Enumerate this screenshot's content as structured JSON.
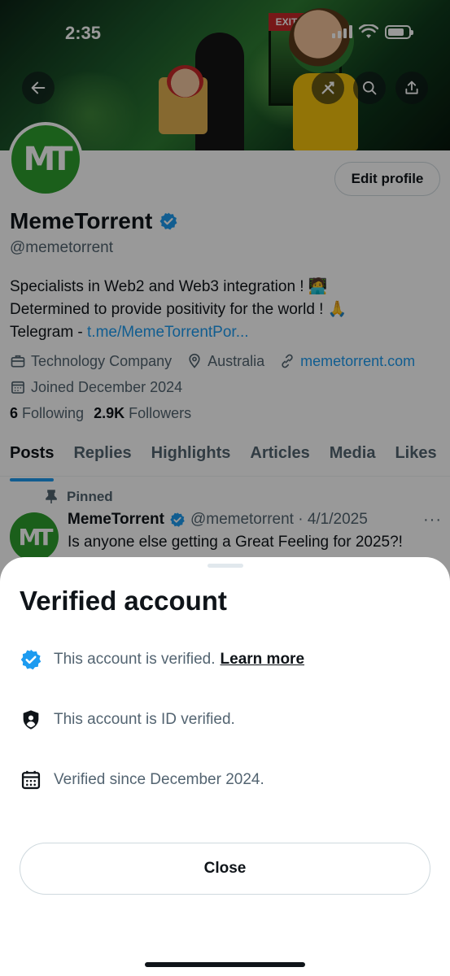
{
  "status_bar": {
    "time": "2:35"
  },
  "profile": {
    "display_name": "MemeTorrent",
    "handle": "@memetorrent",
    "edit_button": "Edit profile",
    "bio_line1": "Specialists in Web2 and Web3 integration ! 🧑‍💻",
    "bio_line2": "Determined to provide positivity for the world ! 🙏",
    "bio_line3_prefix": "Telegram - ",
    "bio_line3_link": "t.me/MemeTorrentPor...",
    "category": "Technology Company",
    "location": "Australia",
    "website": "memetorrent.com",
    "joined": "Joined December 2024",
    "following_count": "6",
    "following_label": "Following",
    "followers_count": "2.9K",
    "followers_label": "Followers",
    "banner_sign": "EXIT",
    "avatar_text": "MT"
  },
  "tabs": [
    "Posts",
    "Replies",
    "Highlights",
    "Articles",
    "Media",
    "Likes"
  ],
  "pinned_post": {
    "pinned_label": "Pinned",
    "name": "MemeTorrent",
    "handle_date": "@memetorrent · 4/1/2025",
    "text": "Is anyone else getting a Great Feeling for 2025?!",
    "more": "···"
  },
  "sheet": {
    "title": "Verified account",
    "verified_text": "This account is verified.",
    "learn_more": "Learn more",
    "id_verified_text": "This account is ID verified.",
    "since_text": "Verified since December 2024.",
    "close_button": "Close"
  },
  "colors": {
    "accent": "#1d9bf0",
    "brand_green": "#2e9e2e"
  },
  "icons": [
    "back-arrow-icon",
    "grok-icon",
    "search-icon",
    "share-icon",
    "verified-badge-icon",
    "briefcase-icon",
    "location-pin-icon",
    "link-icon",
    "calendar-icon",
    "pin-icon",
    "more-icon",
    "shield-person-icon"
  ]
}
